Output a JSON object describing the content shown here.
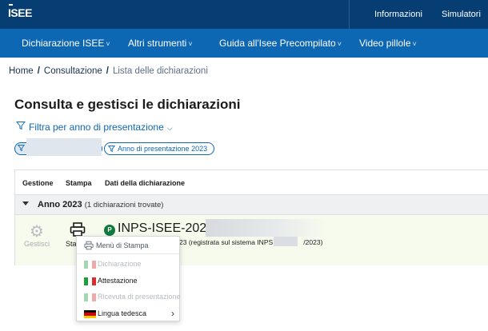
{
  "header": {
    "logo_text": "ISEE",
    "links": [
      "Informazioni",
      "Simulatori"
    ]
  },
  "nav": {
    "items": [
      {
        "label": "Dichiarazione ISEE",
        "chevron": "˅"
      },
      {
        "label": "Altri strumenti",
        "chevron": "˅"
      },
      {
        "label": "Guida all'Isee Precompilato",
        "chevron": "˅"
      },
      {
        "label": "Video pillole",
        "chevron": "˅"
      }
    ]
  },
  "breadcrumb": {
    "home": "Home",
    "sep": "/",
    "consultazione": "Consultazione",
    "current": "Lista delle dichiarazioni"
  },
  "page": {
    "title": "Consulta e gestisci le dichiarazioni",
    "filter_link": "Filtra per anno di presentazione",
    "filter_chip": "Anno di presentazione 2023"
  },
  "table": {
    "headers": {
      "gestione": "Gestione",
      "stampa": "Stampa",
      "dati": "Dati della dichiarazione"
    },
    "group": {
      "title": "Anno 2023",
      "count": "(1 dichiarazioni trovate)"
    },
    "row": {
      "gestisci": "Gestisci",
      "stampa": "Sta",
      "badge": "P",
      "protocol": "INPS-ISEE-2023",
      "registration_prefix": "23 (registrata sul sistema INPS il",
      "registration_suffix": "/2023)"
    }
  },
  "print_menu": {
    "title": "Menù di Stampa",
    "items": [
      {
        "label": "Dichiarazione",
        "disabled": true,
        "flag": "italy"
      },
      {
        "label": "Attestazione",
        "disabled": false,
        "flag": "italy"
      },
      {
        "label": "Ricevuta di presentazione",
        "disabled": true,
        "flag": "italy"
      },
      {
        "label": "Lingua tedesca",
        "disabled": false,
        "flag": "germany",
        "arrow": "›"
      }
    ]
  },
  "colors": {
    "topbar": "#063e73",
    "navbar": "#0d67b3",
    "row_bg": "#f6fbee",
    "badge": "#0f7a3e"
  }
}
